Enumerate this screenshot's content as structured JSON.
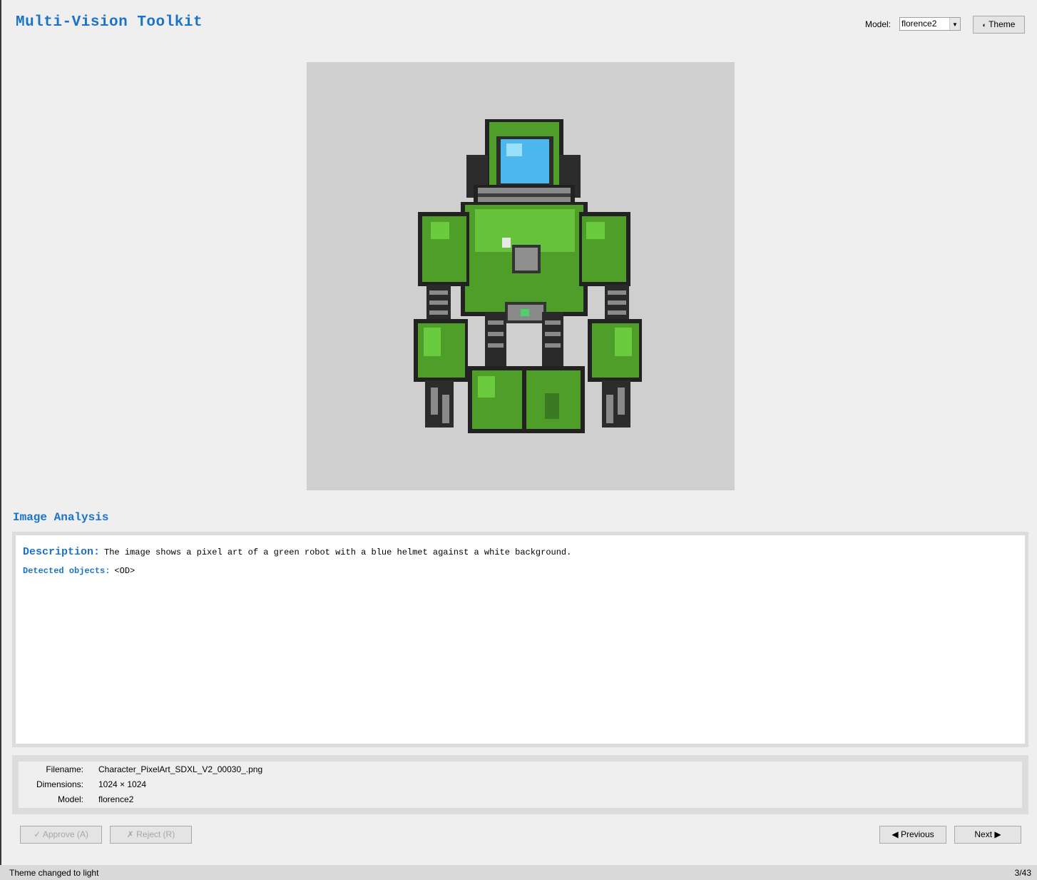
{
  "app": {
    "title": "Multi-Vision Toolkit",
    "model_label": "Model:",
    "model_value": "florence2",
    "theme_button": "Theme",
    "theme_icon": "moon-icon"
  },
  "image": {
    "subject_icon": "pixel-art-green-robot",
    "background_color": "#cfcfcf"
  },
  "analysis": {
    "section_title": "Image Analysis",
    "description_label": "Description:",
    "description_text": "The image shows a pixel art of a green robot with a blue helmet against a white background.",
    "objects_label": "Detected objects:",
    "objects_text": "<OD>"
  },
  "info": [
    {
      "label": "Filename:",
      "value": "Character_PixelArt_SDXL_V2_00030_.png"
    },
    {
      "label": "Dimensions:",
      "value": "1024 × 1024"
    },
    {
      "label": "Model:",
      "value": "florence2"
    }
  ],
  "actions": {
    "approve": "✓ Approve (A)",
    "reject": "✗ Reject (R)",
    "previous": "◀ Previous",
    "next": "Next ▶"
  },
  "status": {
    "message": "Theme changed to light",
    "counter": "3/43"
  },
  "colors": {
    "accent": "#1a73c8",
    "robot_green": "#4f9e2a",
    "visor_blue": "#4db6ec"
  }
}
